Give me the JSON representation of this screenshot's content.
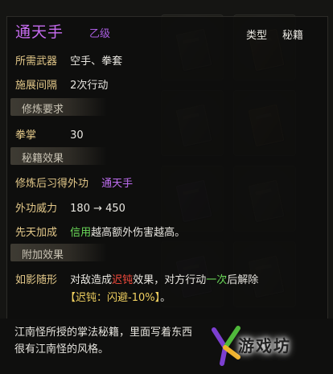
{
  "item": {
    "name": "通天手",
    "grade": "乙级",
    "type_label": "类型",
    "type_value": "秘籍"
  },
  "fields": {
    "weapon_label": "所需武器",
    "weapon_value": "空手、拳套",
    "interval_label": "施展间隔",
    "interval_value": "2次行动"
  },
  "sections": {
    "requirement": "修炼要求",
    "effect": "秘籍效果",
    "extra": "附加效果"
  },
  "requirement": {
    "label": "拳掌",
    "value": "30"
  },
  "effect": {
    "learn_label": "修炼后习得外功",
    "learn_value": "通天手",
    "power_label": "外功威力",
    "power_value": "180 → 450",
    "innate_label": "先天加成",
    "innate_keyword": "信用",
    "innate_text": "越高额外伤害越高。"
  },
  "extra": {
    "name": "如影随形",
    "text_a": "对敌造成",
    "keyword": "迟钝",
    "text_b": "效果，对方行动",
    "count": "一次",
    "text_c": "后解除",
    "detail": "【迟钝：闪避-10%】",
    "period": "。"
  },
  "description": {
    "line1": "江南怪所授的掌法秘籍，里面写着东西",
    "line2": "很有江南怪的风格。"
  },
  "watermark": {
    "text": "游戏坊"
  },
  "colors": {
    "name": "#c76cf0",
    "label": "#e4c98a",
    "green": "#6cdc5a",
    "red": "#f24a3c"
  }
}
